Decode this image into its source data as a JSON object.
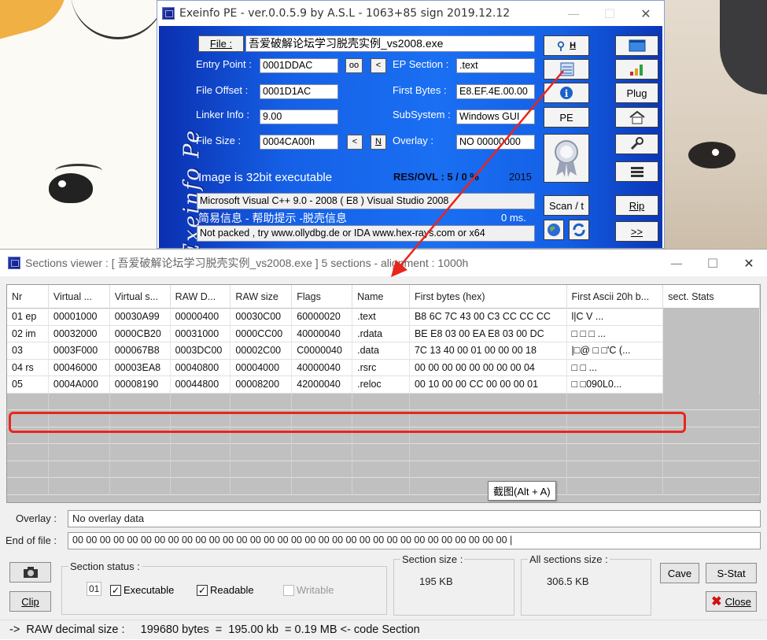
{
  "exeinfo": {
    "title": "Exeinfo PE - ver.0.0.5.9  by A.S.L -  1063+85 sign  2019.12.12",
    "logo_text": "Exeinfo Pe",
    "file_button": "File :",
    "file_name": "吾爱破解论坛学习脱壳实例_vs2008.exe",
    "entry_point_label": "Entry Point :",
    "entry_point": "0001DDAC",
    "oo_button": "oo",
    "lt_button": "<",
    "ep_section_label": "EP Section :",
    "ep_section": ".text",
    "file_offset_label": "File Offset :",
    "file_offset": "0001D1AC",
    "first_bytes_label": "First Bytes :",
    "first_bytes": "E8.EF.4E.00.00",
    "linker_info_label": "Linker Info :",
    "linker_info": "9.00",
    "subsystem_label": "SubSystem :",
    "subsystem": "Windows GUI",
    "file_size_label": "File Size :",
    "file_size": "0004CA00h",
    "n_button": "N",
    "overlay_label": "Overlay :",
    "overlay": "NO  00000000",
    "image_info": "Image is 32bit executable",
    "res_ovl": "RES/OVL : 5 / 0 %",
    "year": "2015",
    "compiler": "Microsoft Visual C++ 9.0 - 2008 ( E8 ) Visual Studio 2008",
    "info_cn": "简易信息 - 帮助提示 -脱壳信息",
    "ms": "0 ms.",
    "packed_info": "Not packed , try  www.ollydbg.de or IDA  www.hex-rays.com  or  x64",
    "h_button": "H",
    "pe_button": "PE",
    "scan_button": "Scan / t",
    "plug_button": "Plug",
    "rip_button": "Rip",
    ">>_button": ">>"
  },
  "sections": {
    "title": "Sections viewer : [ 吾爱破解论坛学习脱壳实例_vs2008.exe ] 5 sections - alignment : 1000h",
    "columns": [
      "Nr",
      "Virtual ...",
      "Virtual s...",
      "RAW D...",
      "RAW size",
      "Flags",
      "Name",
      "First bytes (hex)",
      "First Ascii 20h b...",
      "sect. Stats"
    ],
    "rows": [
      [
        "01 ep",
        "00001000",
        "00030A99",
        "00000400",
        "00030C00",
        "60000020",
        ".text",
        "B8 6C 7C 43 00 C3 CC CC CC",
        "l|C         V     ...",
        ""
      ],
      [
        "02 im",
        "00032000",
        "0000CB20",
        "00031000",
        "0000CC00",
        "40000040",
        ".rdata",
        "BE E8 03 00 EA E8 03 00 DC",
        "  □    □    □    ...",
        ""
      ],
      [
        "03",
        "0003F000",
        "000067B8",
        "0003DC00",
        "00002C00",
        "C0000040",
        ".data",
        "7C 13 40 00 01 00 00 00 18",
        "|□@ □     □'C (...",
        ""
      ],
      [
        "04 rs",
        "00046000",
        "00003EA8",
        "00040800",
        "00004000",
        "40000040",
        ".rsrc",
        "00 00 00 00 00 00 00 00 04",
        "         □        □    ...",
        ""
      ],
      [
        "05",
        "0004A000",
        "00008190",
        "00044800",
        "00008200",
        "42000040",
        ".reloc",
        "00 10 00 00 CC 00 00 00 01",
        " □          □090L0...",
        ""
      ]
    ],
    "tooltip": "截图(Alt + A)",
    "overlay_label": "Overlay :",
    "overlay_value": "No overlay data",
    "eof_label": "End of file :",
    "eof_value": "00 00 00 00 00 00 00 00 00 00 00 00 00 00 00 00 00 00 00 00 00 00 00 00 00 00 00 00 00 00 00 00   |",
    "section_status_label": "Section status :",
    "status_num": "01",
    "executable": "Executable",
    "readable": "Readable",
    "writable": "Writable",
    "section_size_label": "Section size :",
    "section_size": "195 KB",
    "all_sections_label": "All sections size :",
    "all_sections_size": "306.5 KB",
    "clip_button": "Clip",
    "cave_button": "Cave",
    "sstat_button": "S-Stat",
    "close_button": "Close",
    "status_bar": "->  RAW decimal size :     199680 bytes  =  195.00 kb  = 0.19 MB <- code Section"
  }
}
